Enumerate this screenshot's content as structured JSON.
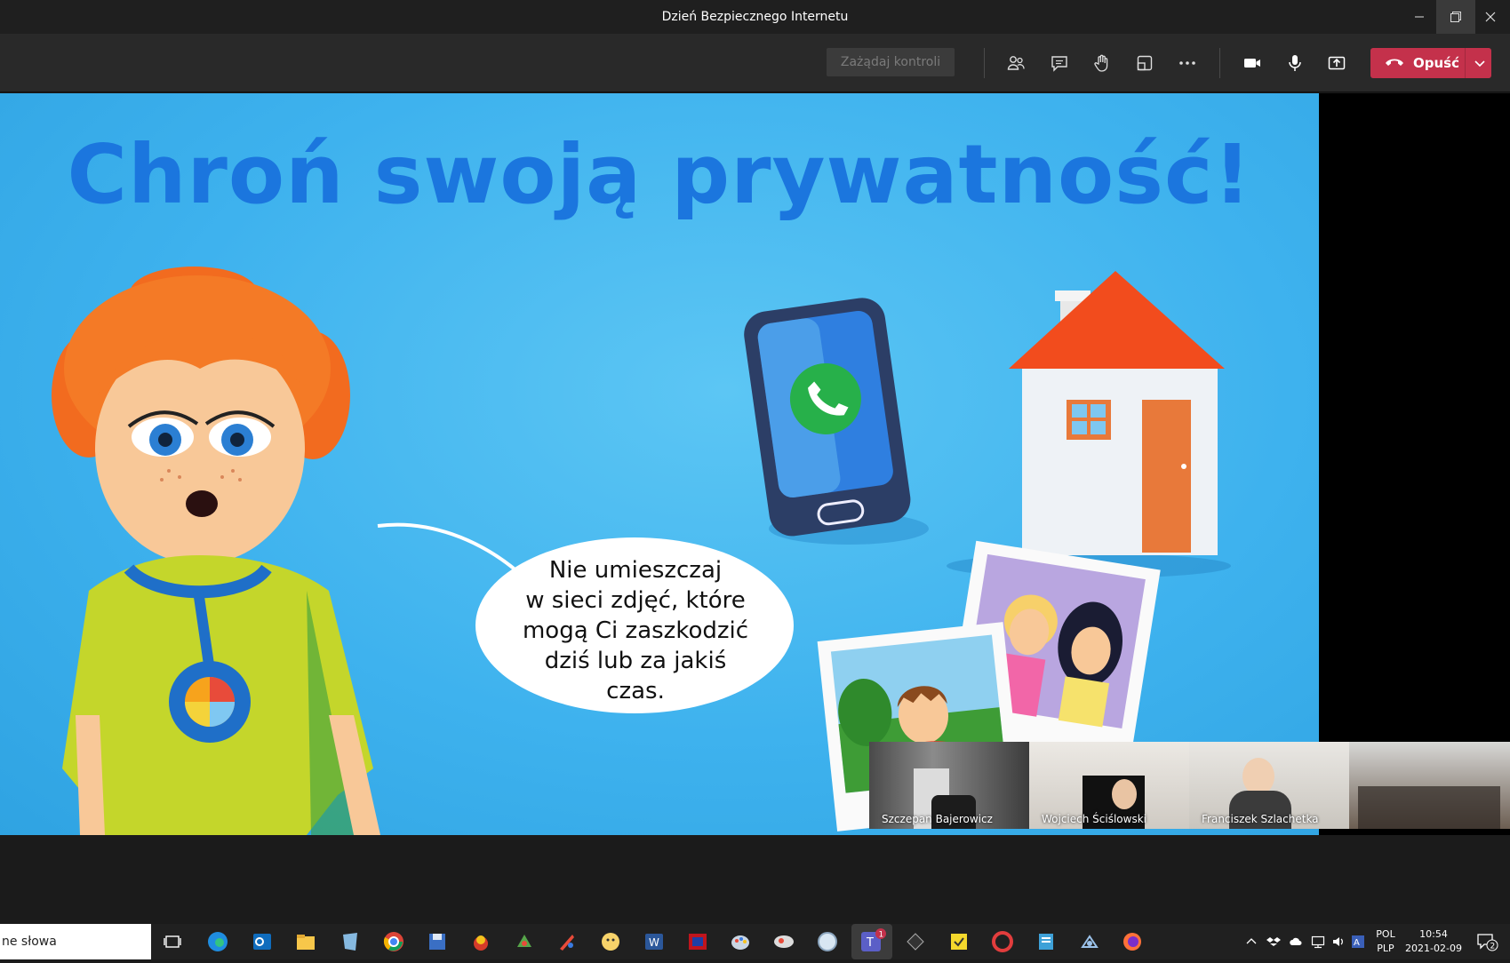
{
  "window": {
    "title": "Dzień Bezpiecznego Internetu",
    "minimize_icon": "minimize-icon",
    "restore_icon": "restore-icon",
    "close_icon": "close-icon"
  },
  "toolbar": {
    "request_control": "Zażądaj kontroli",
    "leave_label": "Opuść",
    "icons": [
      "participants-icon",
      "chat-icon",
      "raise-hand-icon",
      "rooms-icon",
      "more-icon",
      "camera-icon",
      "mic-icon",
      "share-icon"
    ],
    "leave_color": "#c4314b"
  },
  "slide": {
    "title": "Chroń swoją prywatność!",
    "bubble_lines": [
      "Nie umieszczaj",
      "w sieci zdjęć, które",
      "mogą Ci zaszkodzić",
      "dziś lub za jakiś",
      "czas."
    ],
    "title_color": "#1b76de",
    "background_color": "#3eb2ee"
  },
  "participants": [
    {
      "name": "Szczepan Bajerowicz"
    },
    {
      "name": "Wojciech Ściślowski"
    },
    {
      "name": "Franciszek Szlachetka"
    },
    {
      "name": ""
    }
  ],
  "taskbar": {
    "search_text": "ne słowa",
    "lang_top": "POL",
    "lang_bottom": "PLP",
    "time": "10:54",
    "date": "2021-02-09",
    "notifications": "2",
    "teams_badge": "1"
  }
}
